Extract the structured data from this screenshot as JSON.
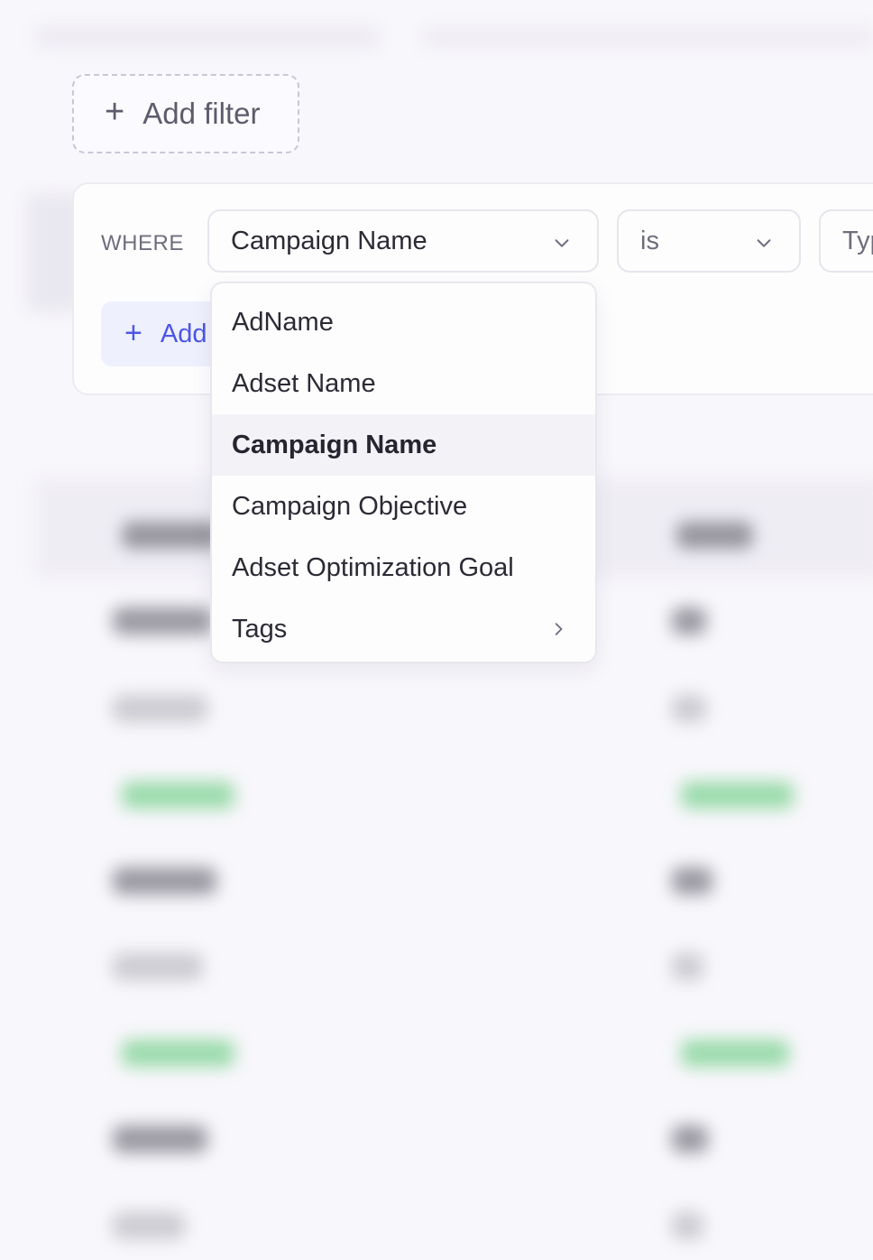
{
  "add_filter_button": {
    "label": "Add filter"
  },
  "filter_row": {
    "where_label": "WHERE",
    "field_value": "Campaign Name",
    "operator_value": "is",
    "value_placeholder": "Type"
  },
  "add_condition_button": {
    "label": "Add"
  },
  "field_dropdown": {
    "items": [
      {
        "label": "AdName",
        "selected": false,
        "has_submenu": false
      },
      {
        "label": "Adset Name",
        "selected": false,
        "has_submenu": false
      },
      {
        "label": "Campaign Name",
        "selected": true,
        "has_submenu": false
      },
      {
        "label": "Campaign Objective",
        "selected": false,
        "has_submenu": false
      },
      {
        "label": "Adset Optimization Goal",
        "selected": false,
        "has_submenu": false
      },
      {
        "label": "Tags",
        "selected": false,
        "has_submenu": true
      }
    ]
  },
  "colors": {
    "accent": "#4d55e6",
    "accent_bg": "#eef0fd",
    "text": "#2b2a35",
    "muted": "#6f6d7e",
    "background": "#f8f7fb"
  }
}
